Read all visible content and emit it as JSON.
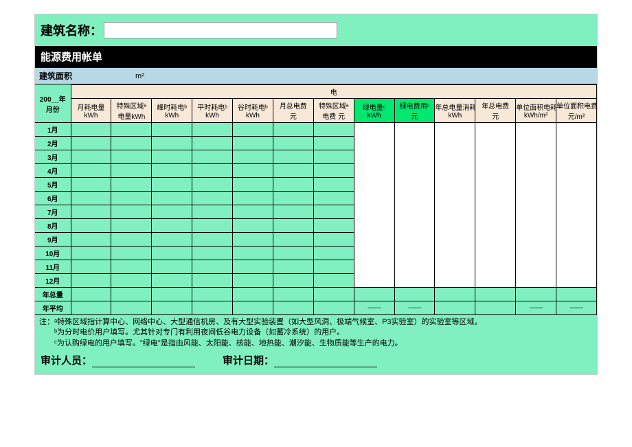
{
  "title_label": "建筑名称：",
  "black_bar": "能源费用帐单",
  "area_label": "建筑面积",
  "area_unit": "m²",
  "group_header": "电",
  "year_label": "200__年",
  "month_label": "月份",
  "columns": [
    {
      "l1": "月耗电量",
      "l2": "kWh"
    },
    {
      "l1": "特殊区域ᵃ",
      "l2": "电量kWh"
    },
    {
      "l1": "峰时耗电ᵇ",
      "l2": "kWh"
    },
    {
      "l1": "平时耗电ᵇ",
      "l2": "kWh"
    },
    {
      "l1": "谷时耗电ᵇ",
      "l2": "kWh"
    },
    {
      "l1": "月总电费",
      "l2": "元"
    },
    {
      "l1": "特殊区域ᵃ",
      "l2": "电费 元"
    },
    {
      "l1": "绿电量ᶜ",
      "l2": "kWh",
      "green": true
    },
    {
      "l1": "绿电费用ᶜ",
      "l2": "元",
      "green": true
    },
    {
      "l1": "年总电量消耗",
      "l2": "kWh"
    },
    {
      "l1": "年总电费",
      "l2": "元"
    },
    {
      "l1": "单位面积电耗",
      "l2": "kWh/m²"
    },
    {
      "l1": "单位面积电费",
      "l2": "元/m²"
    }
  ],
  "months": [
    "1月",
    "2月",
    "3月",
    "4月",
    "5月",
    "6月",
    "7月",
    "8月",
    "9月",
    "10月",
    "11月",
    "12月"
  ],
  "total_label": "年总量",
  "avg_label": "年平均",
  "dash": "——",
  "note_prefix": "注：",
  "note_a": "ᵃ特殊区域指计算中心、网络中心、大型通信机房、及有大型实验装置（如大型风洞、极端气候室、P3实验室）的实验室等区域。",
  "note_b": "ᵇ为分时电价用户填写。尤其针对专门有利用夜间低谷电力设备（如蓄冷系统）的用户。",
  "note_c": "ᶜ为认购绿电的用户填写。\"绿电\"是指由风能、太阳能、核能、地热能、潮汐能、生物质能等生产的电力。",
  "auditor_label": "审计人员：",
  "date_label": "审计日期："
}
